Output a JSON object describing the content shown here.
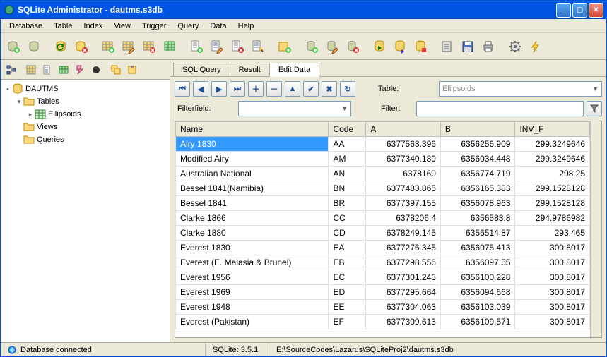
{
  "title": "SQLite Administrator - dautms.s3db",
  "menu": [
    "Database",
    "Table",
    "Index",
    "View",
    "Trigger",
    "Query",
    "Data",
    "Help"
  ],
  "tree": {
    "root": "DAUTMS",
    "tables_label": "Tables",
    "tables": [
      "Ellipsoids"
    ],
    "views_label": "Views",
    "queries_label": "Queries"
  },
  "tabs": [
    "SQL Query",
    "Result",
    "Edit Data"
  ],
  "active_tab": 2,
  "table_label": "Table:",
  "table_value": "Ellipsoids",
  "filterfield_label": "Filterfield:",
  "filter_label": "Filter:",
  "columns": [
    "Name",
    "Code",
    "A",
    "B",
    "INV_F"
  ],
  "rows": [
    {
      "name": "Airy 1830",
      "code": "AA",
      "a": "6377563.396",
      "b": "6356256.909",
      "inv_f": "299.3249646",
      "sel": true
    },
    {
      "name": "Modified Airy",
      "code": "AM",
      "a": "6377340.189",
      "b": "6356034.448",
      "inv_f": "299.3249646"
    },
    {
      "name": "Australian National",
      "code": "AN",
      "a": "6378160",
      "b": "6356774.719",
      "inv_f": "298.25"
    },
    {
      "name": "Bessel 1841(Namibia)",
      "code": "BN",
      "a": "6377483.865",
      "b": "6356165.383",
      "inv_f": "299.1528128"
    },
    {
      "name": "Bessel 1841",
      "code": "BR",
      "a": "6377397.155",
      "b": "6356078.963",
      "inv_f": "299.1528128"
    },
    {
      "name": "Clarke 1866",
      "code": "CC",
      "a": "6378206.4",
      "b": "6356583.8",
      "inv_f": "294.9786982"
    },
    {
      "name": "Clarke 1880",
      "code": "CD",
      "a": "6378249.145",
      "b": "6356514.87",
      "inv_f": "293.465"
    },
    {
      "name": "Everest 1830",
      "code": "EA",
      "a": "6377276.345",
      "b": "6356075.413",
      "inv_f": "300.8017"
    },
    {
      "name": "Everest (E. Malasia & Brunei)",
      "code": "EB",
      "a": "6377298.556",
      "b": "6356097.55",
      "inv_f": "300.8017"
    },
    {
      "name": "Everest 1956",
      "code": "EC",
      "a": "6377301.243",
      "b": "6356100.228",
      "inv_f": "300.8017"
    },
    {
      "name": "Everest 1969",
      "code": "ED",
      "a": "6377295.664",
      "b": "6356094.668",
      "inv_f": "300.8017"
    },
    {
      "name": "Everest 1948",
      "code": "EE",
      "a": "6377304.063",
      "b": "6356103.039",
      "inv_f": "300.8017"
    },
    {
      "name": "Everest (Pakistan)",
      "code": "EF",
      "a": "6377309.613",
      "b": "6356109.571",
      "inv_f": "300.8017"
    }
  ],
  "status": {
    "conn": "Database connected",
    "ver": "SQLite: 3.5.1",
    "path": "E:\\SourceCodes\\Lazarus\\SQLiteProj2\\dautms.s3db"
  }
}
